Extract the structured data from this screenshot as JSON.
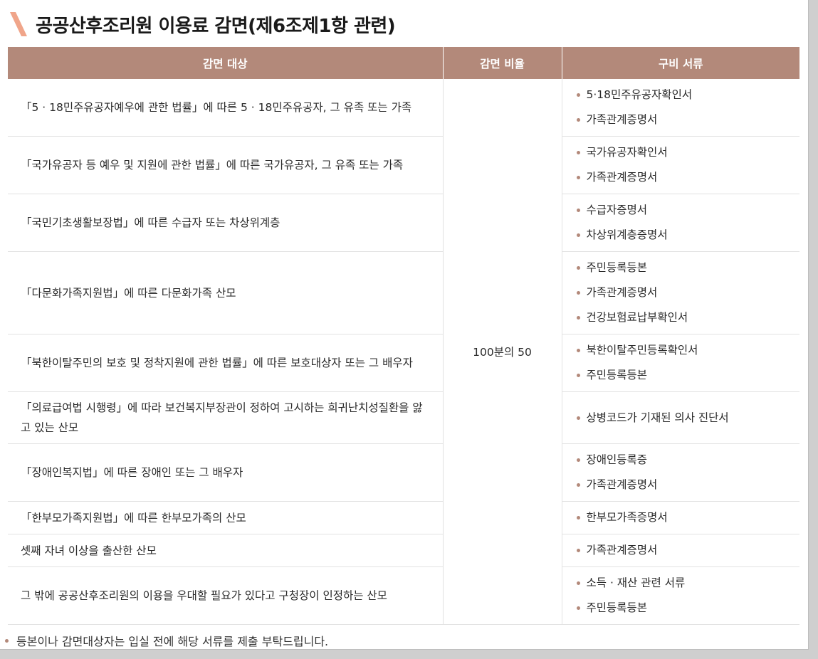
{
  "title": "공공산후조리원 이용료 감면(제6조제1항 관련)",
  "colors": {
    "accent": "#b3897a",
    "slash": "#f0a58a"
  },
  "icons": {
    "heading": "diagonal-slash-icon",
    "bullet": "bullet-dot-icon"
  },
  "table": {
    "headers": {
      "target": "감면 대상",
      "rate": "감면 비율",
      "docs": "구비 서류"
    },
    "rate": "100분의 50",
    "rows": [
      {
        "target": "「5 · 18민주유공자예우에 관한 법률」에 따른 5 · 18민주유공자, 그 유족 또는 가족",
        "docs": [
          "5·18민주유공자확인서",
          "가족관계증명서"
        ]
      },
      {
        "target": "「국가유공자 등 예우 및 지원에 관한 법률」에 따른 국가유공자, 그 유족 또는 가족",
        "docs": [
          "국가유공자확인서",
          "가족관계증명서"
        ]
      },
      {
        "target": "「국민기초생활보장법」에 따른 수급자 또는 차상위계층",
        "docs": [
          "수급자증명서",
          "차상위계층증명서"
        ]
      },
      {
        "target": "「다문화가족지원법」에 따른 다문화가족 산모",
        "docs": [
          "주민등록등본",
          "가족관계증명서",
          "건강보험료납부확인서"
        ]
      },
      {
        "target": "「북한이탈주민의 보호 및 정착지원에 관한 법률」에 따른 보호대상자 또는 그 배우자",
        "docs": [
          "북한이탈주민등록확인서",
          "주민등록등본"
        ]
      },
      {
        "target": "「의료급여법 시행령」에 따라 보건복지부장관이 정하여 고시하는 희귀난치성질환을 앓고 있는 산모",
        "docs": [
          "상병코드가 기재된 의사 진단서"
        ]
      },
      {
        "target": "「장애인복지법」에 따른 장애인 또는 그 배우자",
        "docs": [
          "장애인등록증",
          "가족관계증명서"
        ]
      },
      {
        "target": "「한부모가족지원법」에 따른 한부모가족의 산모",
        "docs": [
          "한부모가족증명서"
        ]
      },
      {
        "target": "셋째 자녀 이상을 출산한 산모",
        "docs": [
          "가족관계증명서"
        ]
      },
      {
        "target": "그 밖에 공공산후조리원의 이용을 우대할 필요가 있다고 구청장이 인정하는 산모",
        "docs": [
          "소득 · 재산 관련 서류",
          "주민등록등본"
        ]
      }
    ]
  },
  "note": "등본이나 감면대상자는 입실 전에 해당 서류를 제출 부탁드립니다."
}
